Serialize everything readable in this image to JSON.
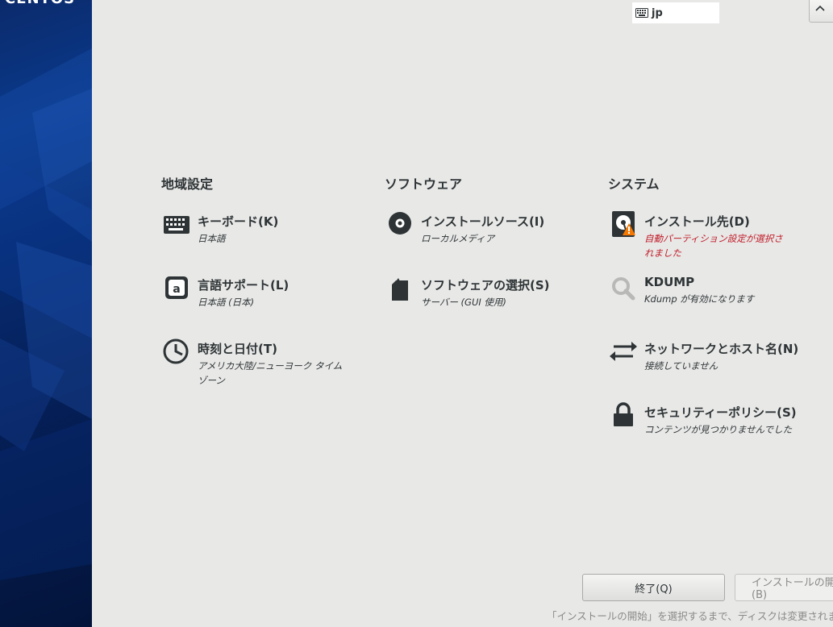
{
  "brand": "CENTOS",
  "keyboard_layout": "jp",
  "sections": {
    "localization": "地域設定",
    "software": "ソフトウェア",
    "system": "システム"
  },
  "spokes": {
    "keyboard": {
      "title": "キーボード(K)",
      "status": "日本語"
    },
    "language": {
      "title": "言語サポート(L)",
      "status": "日本語 (日本)"
    },
    "datetime": {
      "title": "時刻と日付(T)",
      "status": "アメリカ大陸/ニューヨーク タイムゾーン"
    },
    "source": {
      "title": "インストールソース(I)",
      "status": "ローカルメディア"
    },
    "software": {
      "title": "ソフトウェアの選択(S)",
      "status": "サーバー (GUI 使用)"
    },
    "destination": {
      "title": "インストール先(D)",
      "status": "自動パーティション設定が選択されました"
    },
    "kdump": {
      "title": "KDUMP",
      "status": "Kdump が有効になります"
    },
    "network": {
      "title": "ネットワークとホスト名(N)",
      "status": "接続していません"
    },
    "security": {
      "title": "セキュリティーポリシー(S)",
      "status": "コンテンツが見つかりませんでした"
    }
  },
  "buttons": {
    "quit": "終了(Q)",
    "begin": "インストールの開始(B)"
  },
  "footer_note": "「インストールの開始」を選択するまで、ディスクは変更されません。",
  "colors": {
    "background": "#e8e8e7",
    "sidebar": "#0a3a8c",
    "warning_text": "#c01c28",
    "warning_badge": "#f57900"
  }
}
